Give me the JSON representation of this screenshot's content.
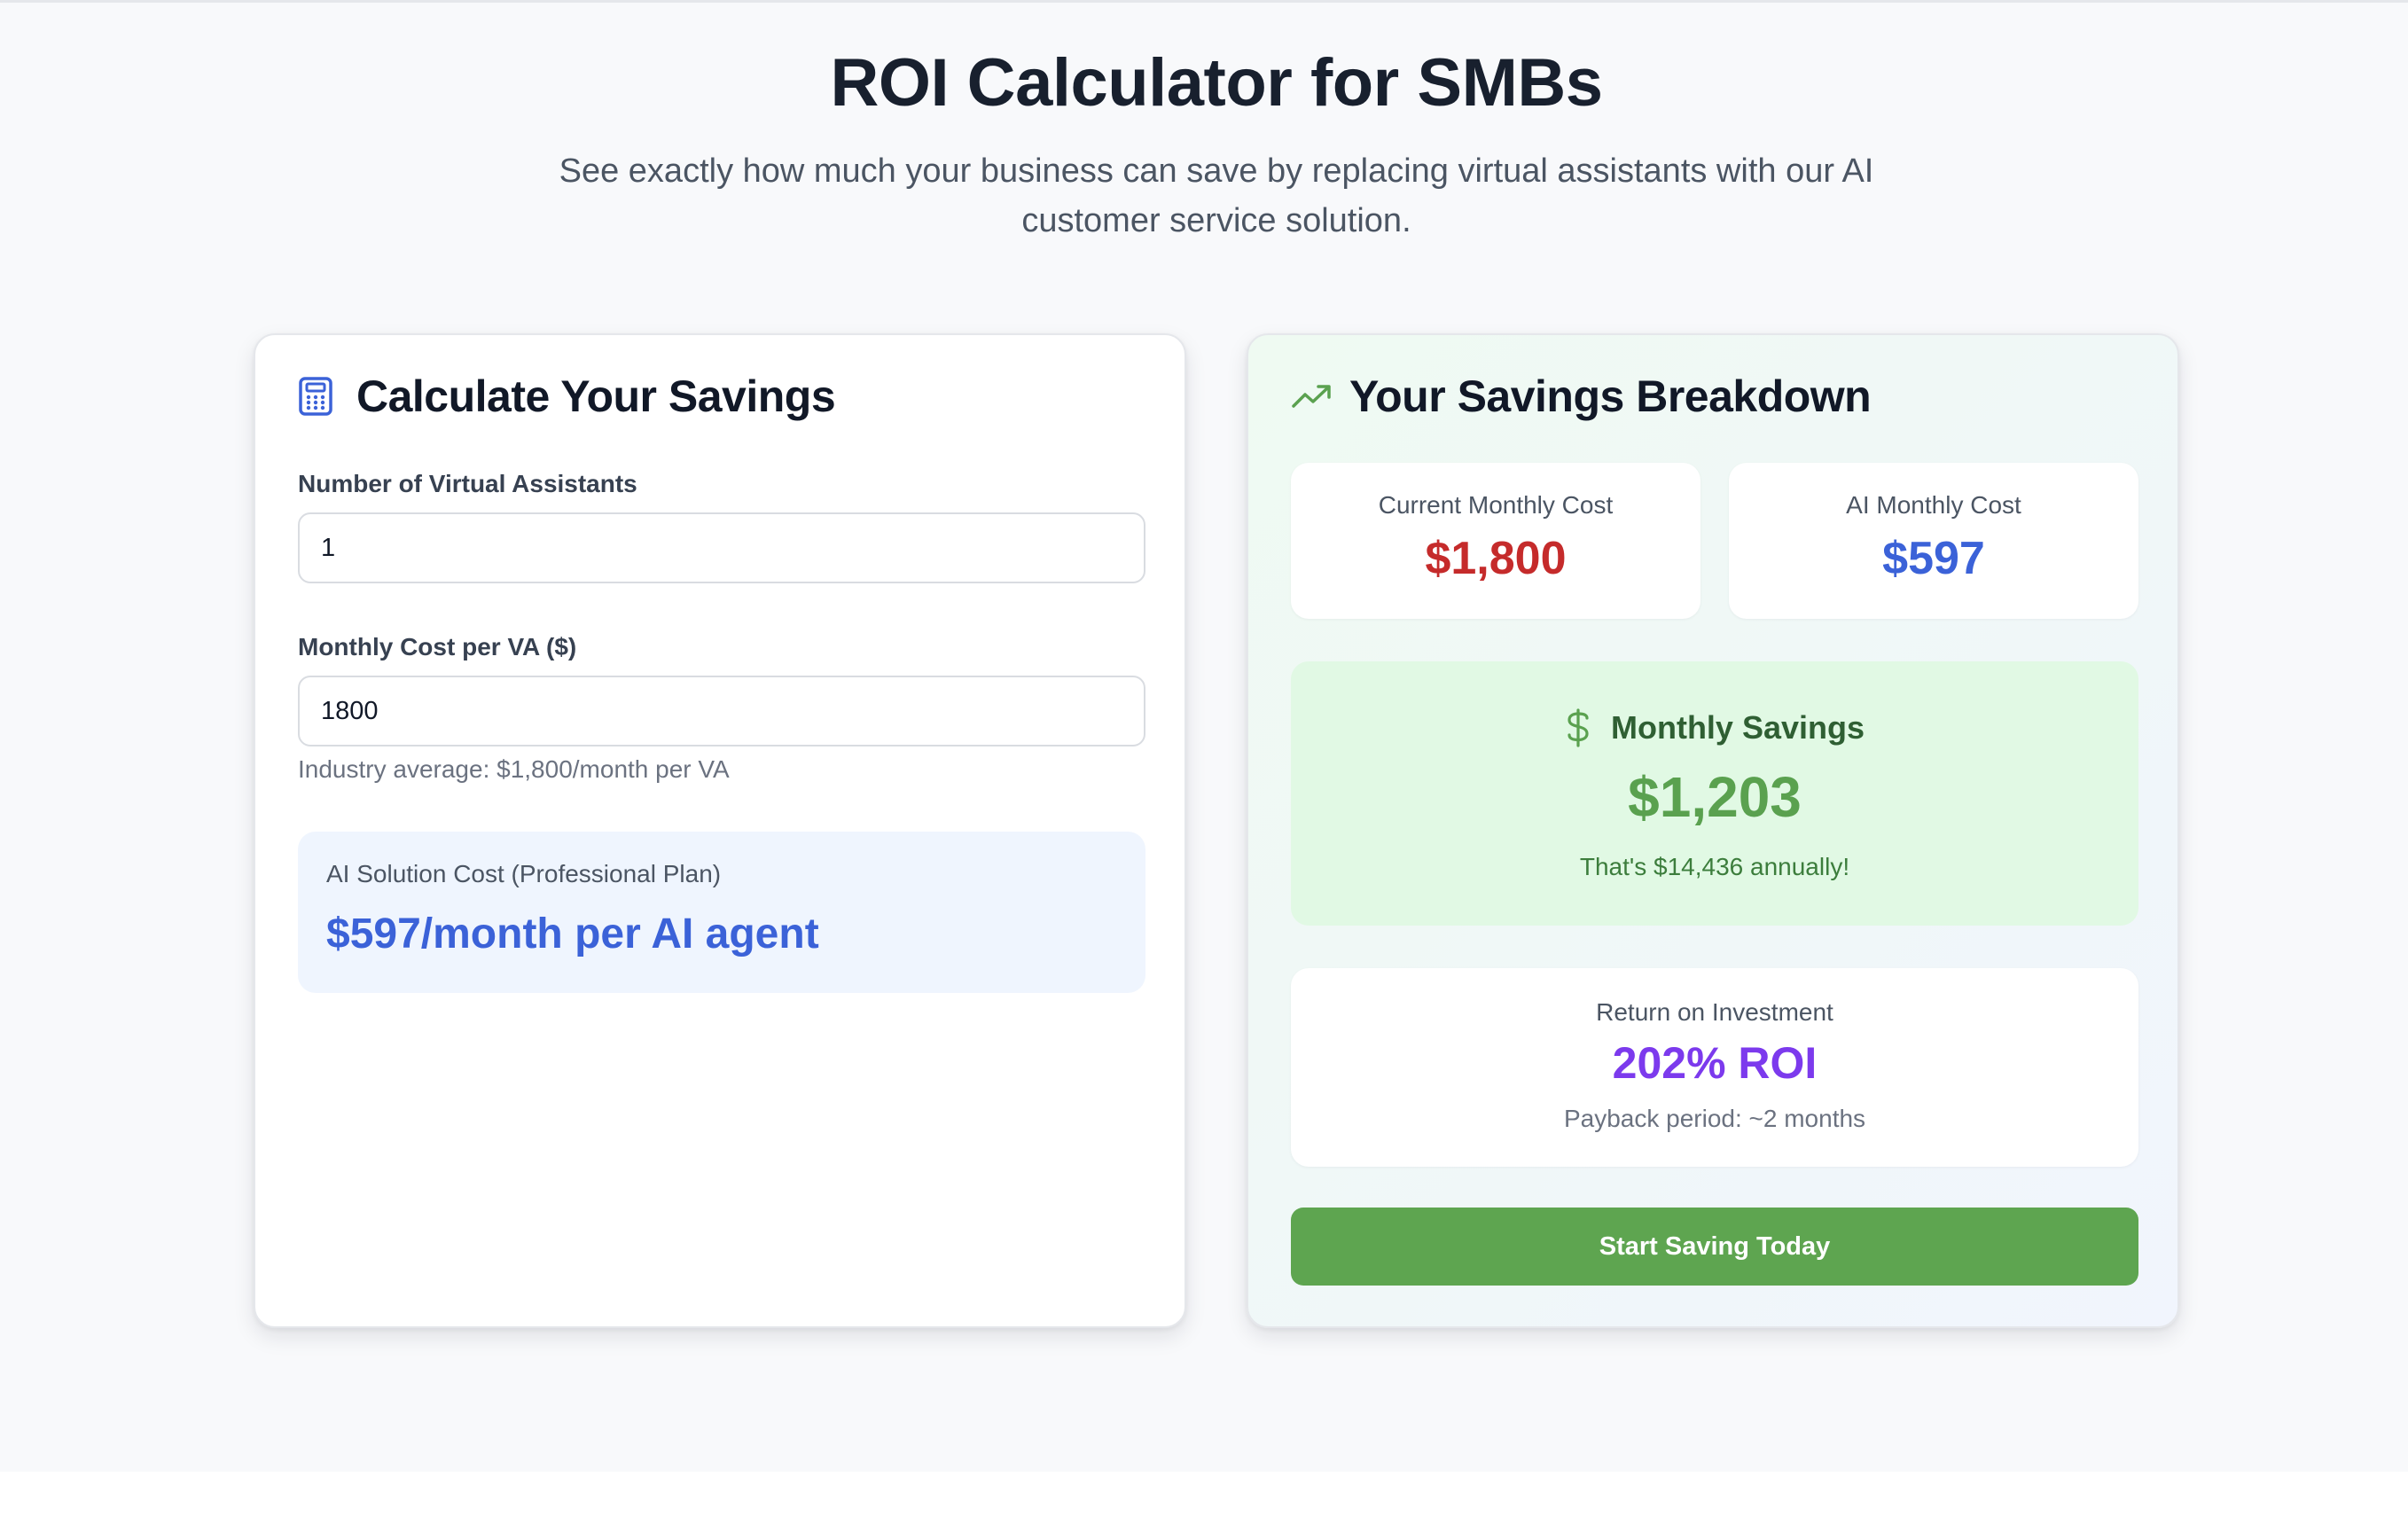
{
  "header": {
    "title": "ROI Calculator for SMBs",
    "subtitle": "See exactly how much your business can save by replacing virtual assistants with our AI customer service solution."
  },
  "calculator": {
    "title": "Calculate Your Savings",
    "icon": "calculator-icon",
    "va_count": {
      "label": "Number of Virtual Assistants",
      "value": "1"
    },
    "va_cost": {
      "label": "Monthly Cost per VA ($)",
      "value": "1800",
      "hint": "Industry average: $1,800/month per VA"
    },
    "ai_solution": {
      "label": "AI Solution Cost (Professional Plan)",
      "value": "$597/month per AI agent"
    }
  },
  "breakdown": {
    "title": "Your Savings Breakdown",
    "icon": "trending-up-icon",
    "current_cost": {
      "label": "Current Monthly Cost",
      "value": "$1,800"
    },
    "ai_cost": {
      "label": "AI Monthly Cost",
      "value": "$597"
    },
    "monthly_savings": {
      "label": "Monthly Savings",
      "value": "$1,203",
      "note": "That's $14,436 annually!",
      "icon": "dollar-icon"
    },
    "roi": {
      "label": "Return on Investment",
      "value": "202% ROI",
      "note": "Payback period: ~2 months"
    },
    "cta_label": "Start Saving Today"
  },
  "colors": {
    "red": "#c52b2b",
    "blue": "#3b62d8",
    "green": "#5aa14f",
    "purple": "#7c3aed",
    "button": "#5ea550"
  }
}
